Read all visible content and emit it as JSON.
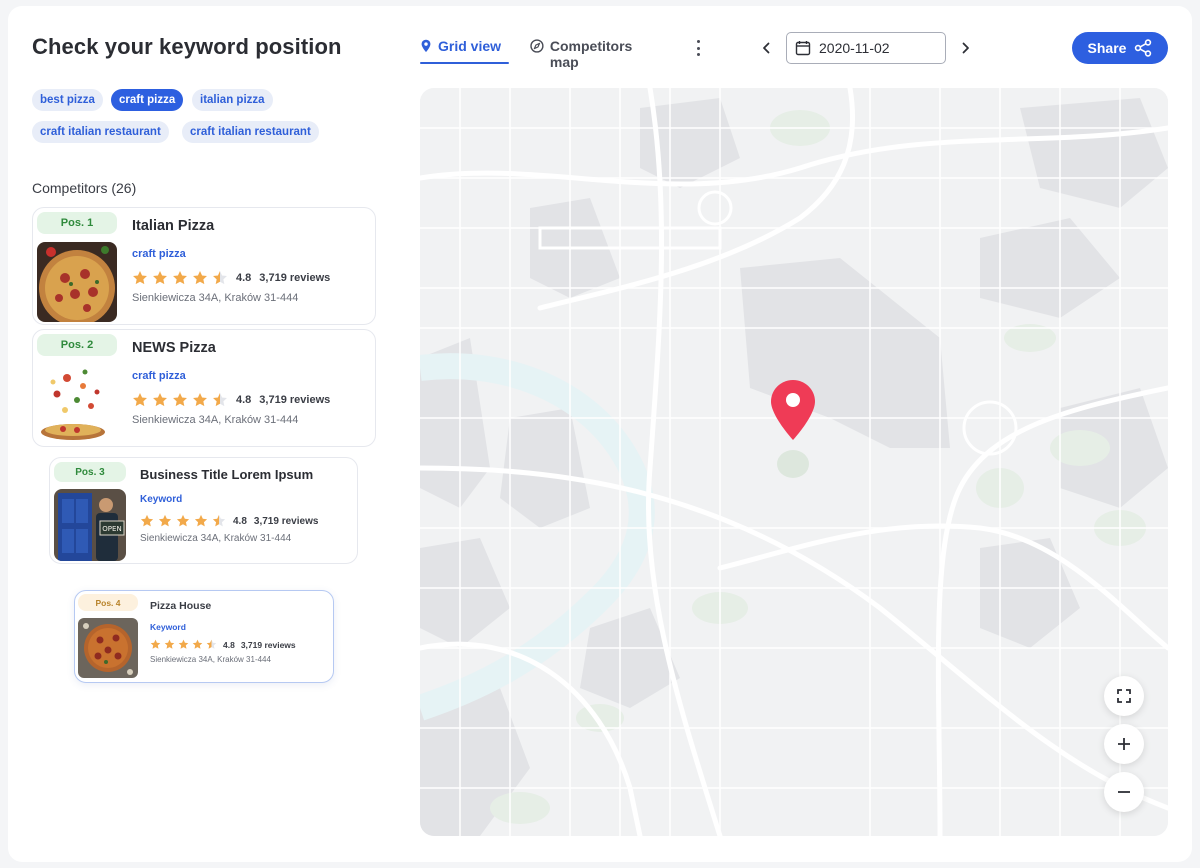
{
  "header": {
    "title": "Check your keyword position",
    "tabs": [
      {
        "label": "Grid view",
        "icon": "location-pin-icon",
        "active": true
      },
      {
        "label": "Competitors map",
        "icon": "compass-icon",
        "active": false
      }
    ],
    "more_icon": "more-vertical-icon",
    "date": {
      "value": "2020-11-02",
      "icon": "calendar-icon"
    },
    "share": {
      "label": "Share",
      "icon": "share-icon"
    }
  },
  "keywords": [
    {
      "label": "best pizza",
      "selected": false
    },
    {
      "label": "craft pizza",
      "selected": true
    },
    {
      "label": "italian pizza",
      "selected": false
    },
    {
      "label": "craft italian restaurant",
      "selected": false
    },
    {
      "label": "craft italian restaurant",
      "selected": false
    }
  ],
  "competitors": {
    "label": "Competitors",
    "count": "(26)",
    "items": [
      {
        "pos": "Pos. 1",
        "name": "Italian Pizza",
        "keyword": "craft pizza",
        "rating": "4.8",
        "rating_value": 4.5,
        "reviews": "3,719 reviews",
        "address": "Sienkiewicza 34A, Kraków 31-444"
      },
      {
        "pos": "Pos. 2",
        "name": "NEWS Pizza",
        "keyword": "craft pizza",
        "rating": "4.8",
        "rating_value": 4.5,
        "reviews": "3,719 reviews",
        "address": "Sienkiewicza 34A, Kraków 31-444"
      },
      {
        "pos": "Pos. 3",
        "name": "Business Title Lorem Ipsum",
        "keyword": "Keyword",
        "rating": "4.8",
        "rating_value": 4.5,
        "reviews": "3,719 reviews",
        "address": "Sienkiewicza 34A, Kraków 31-444"
      },
      {
        "pos": "Pos. 4",
        "name": "Pizza House",
        "keyword": "Keyword",
        "rating": "4.8",
        "rating_value": 4.5,
        "reviews": "3,719 reviews",
        "address": "Sienkiewicza 34A, Kraków 31-444"
      }
    ]
  },
  "map": {
    "marker_color": "#ef3b56",
    "controls": [
      {
        "icon": "fullscreen-icon"
      },
      {
        "icon": "zoom-in-icon"
      },
      {
        "icon": "zoom-out-icon"
      }
    ]
  },
  "colors": {
    "accent": "#2d5fe0",
    "star": "#f2a94a",
    "pos_green": "#e4f4e6",
    "pos_orange": "#fdf1de"
  }
}
